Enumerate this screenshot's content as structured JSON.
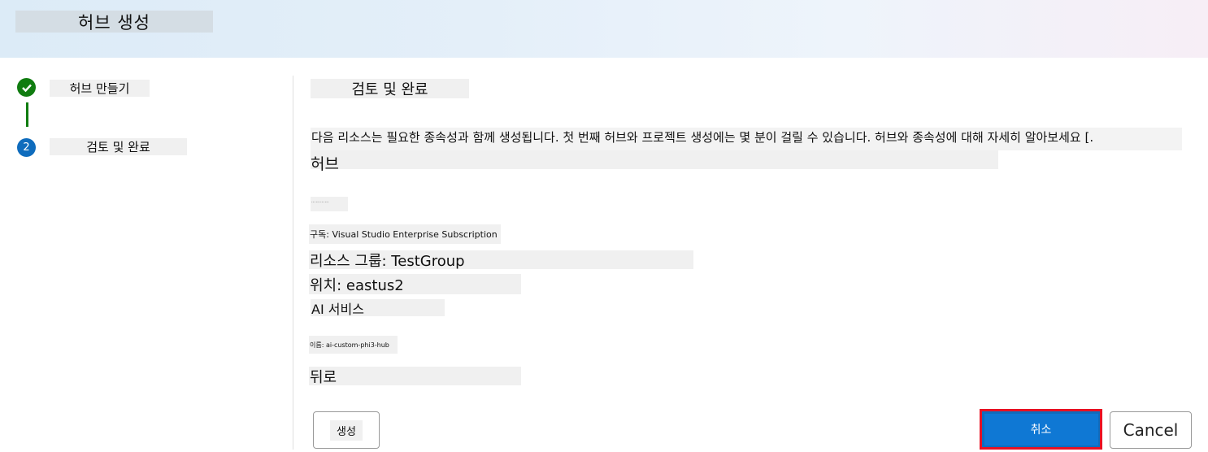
{
  "header": {
    "title": "허브 생성"
  },
  "steps": [
    {
      "label": "허브 만들기",
      "status": "complete",
      "icon": "check-icon"
    },
    {
      "label": "검토 및 완료",
      "status": "current",
      "number": "2"
    }
  ],
  "review": {
    "section_title": "검토 및 완료",
    "description": "다음 리소스는 필요한 종속성과 함께 생성됩니다. 첫 번째 허브와 프로젝트 생성에는 몇 분이 걸릴 수 있습니다. 허브와 종속성에 대해 자세히 알아보세요 [.",
    "hub_title": "허브",
    "tiny_label": "…………",
    "subscription": "구독: Visual Studio Enterprise Subscription",
    "resource_group": "리소스 그룹: TestGroup",
    "location": "위치: eastus2",
    "ai_services": "AI 서비스",
    "name": "이름: ai-custom-phi3-hub",
    "back": "뒤로"
  },
  "footer": {
    "create_label": "생성",
    "cancel_kr_label": "취소",
    "cancel_label": "Cancel"
  },
  "colors": {
    "accent": "#0f6cbd",
    "success": "#107c10",
    "highlight_border": "#e81123"
  }
}
